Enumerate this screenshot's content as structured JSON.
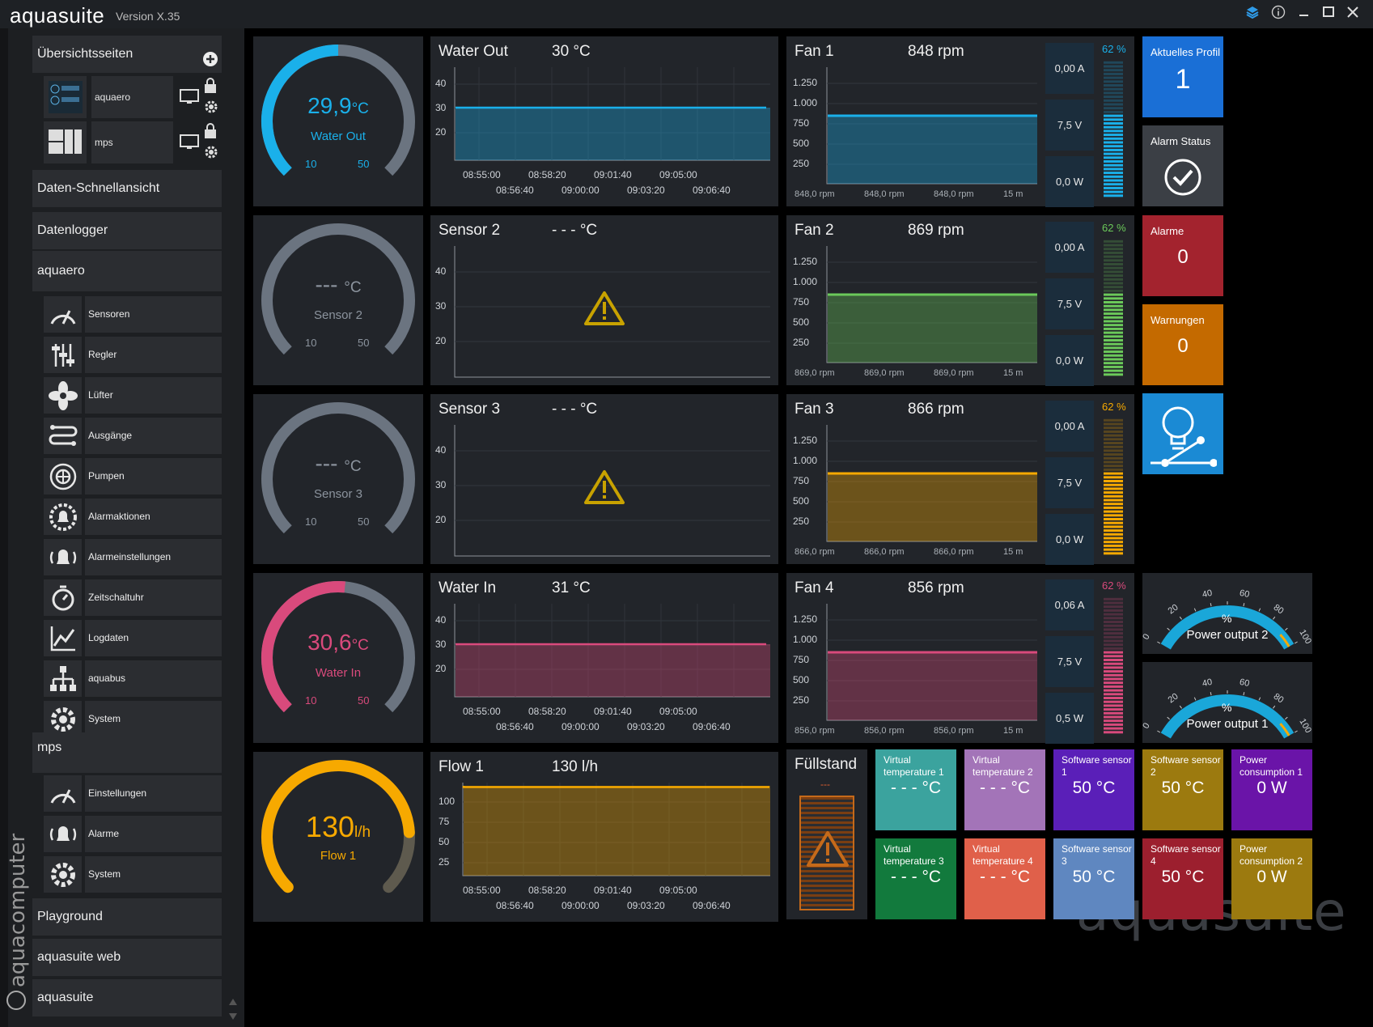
{
  "app": {
    "title": "aquasuite",
    "version": "Version X.35",
    "watermark": "aquasuite",
    "brand_vertical": "aquacomputer"
  },
  "sidebar": {
    "overview_header": "Übersichtsseiten",
    "overview_pages": [
      {
        "label": "aquaero"
      },
      {
        "label": "mps"
      }
    ],
    "quickview": "Daten-Schnellansicht",
    "datalogger": "Datenlogger",
    "aquaero_header": "aquaero",
    "aquaero_items": [
      {
        "label": "Sensoren",
        "icon": "gauge-icon"
      },
      {
        "label": "Regler",
        "icon": "sliders-icon"
      },
      {
        "label": "Lüfter",
        "icon": "fan-icon"
      },
      {
        "label": "Ausgänge",
        "icon": "outputs-icon"
      },
      {
        "label": "Pumpen",
        "icon": "pump-icon"
      },
      {
        "label": "Alarmaktionen",
        "icon": "alarm-gear-icon"
      },
      {
        "label": "Alarmeinstellungen",
        "icon": "bell-icon"
      },
      {
        "label": "Zeitschaltuhr",
        "icon": "timer-icon"
      },
      {
        "label": "Logdaten",
        "icon": "chart-icon"
      },
      {
        "label": "aquabus",
        "icon": "network-icon"
      },
      {
        "label": "System",
        "icon": "gear-icon"
      }
    ],
    "mps_header": "mps",
    "mps_items": [
      {
        "label": "Einstellungen",
        "icon": "gauge-icon"
      },
      {
        "label": "Alarme",
        "icon": "bell-icon"
      },
      {
        "label": "System",
        "icon": "gear-icon"
      }
    ],
    "playground": "Playground",
    "web": "aquasuite web",
    "aquasuite": "aquasuite"
  },
  "gauges": [
    {
      "value": "29,9",
      "unit": "°C",
      "name": "Water Out",
      "min": "10",
      "max": "50",
      "color": "#1ab0ea",
      "fill": 0.5
    },
    {
      "value": "--- ",
      "unit": "°C",
      "name": "Sensor 2",
      "min": "10",
      "max": "50",
      "color": "#6b7480",
      "fill": 0
    },
    {
      "value": "--- ",
      "unit": "°C",
      "name": "Sensor 3",
      "min": "10",
      "max": "50",
      "color": "#6b7480",
      "fill": 0
    },
    {
      "value": "30,6",
      "unit": "°C",
      "name": "Water In",
      "min": "10",
      "max": "50",
      "color": "#d94a7c",
      "fill": 0.52
    },
    {
      "value": "130",
      "unit": "l/h",
      "name": "Flow 1",
      "min": "",
      "max": "",
      "color": "#f7a900",
      "fill": 0.82
    }
  ],
  "charts": [
    {
      "title": "Water Out",
      "value": "30 °C",
      "yticks": [
        "40",
        "30",
        "20"
      ],
      "x_top": [
        "08:55:00",
        "08:58:20",
        "09:01:40",
        "09:05:00"
      ],
      "x_bottom": [
        "08:56:40",
        "09:00:00",
        "09:03:20",
        "09:06:40"
      ],
      "color": "#1ab0ea"
    },
    {
      "title": "Sensor 2",
      "value": "- - - °C",
      "yticks": [
        "40",
        "30",
        "20"
      ],
      "x_top": [],
      "x_bottom": [],
      "color": "#c8a200"
    },
    {
      "title": "Sensor 3",
      "value": "- - - °C",
      "yticks": [
        "40",
        "30",
        "20"
      ],
      "x_top": [],
      "x_bottom": [],
      "color": "#c8a200"
    },
    {
      "title": "Water In",
      "value": "31 °C",
      "yticks": [
        "40",
        "30",
        "20"
      ],
      "x_top": [
        "08:55:00",
        "08:58:20",
        "09:01:40",
        "09:05:00"
      ],
      "x_bottom": [
        "08:56:40",
        "09:00:00",
        "09:03:20",
        "09:06:40"
      ],
      "color": "#d94a7c"
    },
    {
      "title": "Flow 1",
      "value": "130 l/h",
      "yticks": [
        "100",
        "75",
        "50",
        "25"
      ],
      "x_top": [
        "08:55:00",
        "08:58:20",
        "09:01:40",
        "09:05:00"
      ],
      "x_bottom": [
        "08:56:40",
        "09:00:00",
        "09:03:20",
        "09:06:40"
      ],
      "color": "#f7a900"
    }
  ],
  "fans": [
    {
      "title": "Fan 1",
      "rpm": "848 rpm",
      "current": "0,00 A",
      "voltage": "7,5 V",
      "power": "0,0 W",
      "percent": "62 %",
      "stats": [
        "848,0 rpm",
        "848,0 rpm",
        "848,0 rpm",
        "15 m"
      ],
      "color": "#1ab0ea"
    },
    {
      "title": "Fan 2",
      "rpm": "869 rpm",
      "current": "0,00 A",
      "voltage": "7,5 V",
      "power": "0,0 W",
      "percent": "62 %",
      "stats": [
        "869,0 rpm",
        "869,0 rpm",
        "869,0 rpm",
        "15 m"
      ],
      "color": "#6bc95a"
    },
    {
      "title": "Fan 3",
      "rpm": "866 rpm",
      "current": "0,00 A",
      "voltage": "7,5 V",
      "power": "0,0 W",
      "percent": "62 %",
      "stats": [
        "866,0 rpm",
        "866,0 rpm",
        "866,0 rpm",
        "15 m"
      ],
      "color": "#f7a900"
    },
    {
      "title": "Fan 4",
      "rpm": "856 rpm",
      "current": "0,06 A",
      "voltage": "7,5 V",
      "power": "0,5 W",
      "percent": "62 %",
      "stats": [
        "856,0 rpm",
        "856,0 rpm",
        "856,0 rpm",
        "15 m"
      ],
      "color": "#d94a7c"
    }
  ],
  "fan_yticks": [
    "1.250",
    "1.000",
    "750",
    "500",
    "250"
  ],
  "status": {
    "profile": {
      "title": "Aktuelles Profil",
      "value": "1",
      "color": "#1a6fd6"
    },
    "alarm_status": {
      "title": "Alarm Status",
      "color": "#3b3f45"
    },
    "alarms": {
      "title": "Alarme",
      "value": "0",
      "color": "#a3232e"
    },
    "warnings": {
      "title": "Warnungen",
      "value": "0",
      "color": "#c46a00"
    },
    "light": {
      "color": "#1b8ad4"
    }
  },
  "power_gauges": [
    {
      "label": "Power output 2",
      "unit": "%",
      "ticks": [
        "0",
        "20",
        "40",
        "60",
        "80",
        "100"
      ]
    },
    {
      "label": "Power output 1",
      "unit": "%",
      "ticks": [
        "0",
        "20",
        "40",
        "60",
        "80",
        "100"
      ]
    }
  ],
  "fill_level": {
    "title": "Füllstand",
    "value": "---"
  },
  "sensor_tiles": [
    {
      "name": "Virtual temperature 1",
      "value": "- - - °C",
      "color": "#3ba39e"
    },
    {
      "name": "Virtual temperature 2",
      "value": "- - - °C",
      "color": "#a374b8"
    },
    {
      "name": "Software sensor 1",
      "value": "50 °C",
      "color": "#5a1fb8"
    },
    {
      "name": "Software sensor 2",
      "value": "50 °C",
      "color": "#9c7a0f"
    },
    {
      "name": "Power consumption 1",
      "value": "0 W",
      "color": "#6a14a8"
    },
    {
      "name": "Virtual temperature 3",
      "value": "- - - °C",
      "color": "#127a3d"
    },
    {
      "name": "Virtual temperature 4",
      "value": "- - - °C",
      "color": "#e0604a"
    },
    {
      "name": "Software sensor 3",
      "value": "50 °C",
      "color": "#5f87c0"
    },
    {
      "name": "Software sensor 4",
      "value": "50 °C",
      "color": "#9c1f2e"
    },
    {
      "name": "Power consumption 2",
      "value": "0 W",
      "color": "#9c7a0f"
    }
  ]
}
